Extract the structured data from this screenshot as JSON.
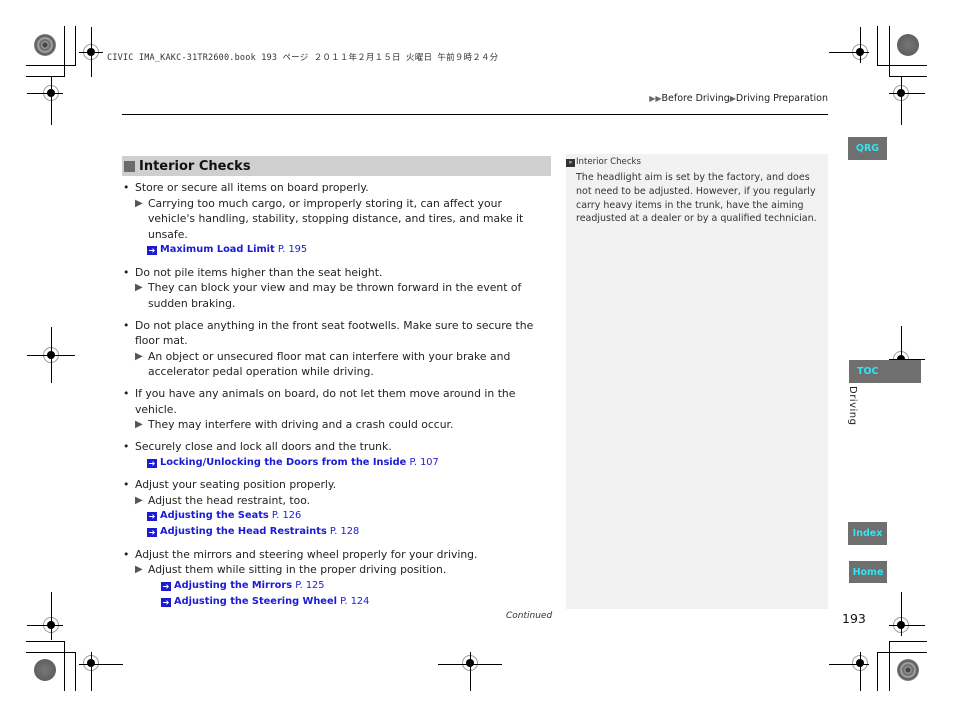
{
  "print_header": "CIVIC IMA_KAKC-31TR2600.book  193 ページ  ２０１１年２月１５日  火曜日  午前９時２４分",
  "breadcrumb": {
    "arrows": "▶▶",
    "part1": "Before Driving",
    "sep": "▶",
    "part2": "Driving Preparation"
  },
  "section": {
    "heading": "Interior Checks",
    "items": [
      {
        "text": "Store or secure all items on board properly.",
        "sub": "Carrying too much cargo, or improperly storing it, can affect your vehicle's handling, stability, stopping distance, and tires, and make it unsafe.",
        "refs": [
          {
            "title": "Maximum Load Limit",
            "page": "P. 195"
          }
        ]
      },
      {
        "text": "Do not pile items higher than the seat height.",
        "sub": "They can block your view and may be thrown forward in the event of sudden braking."
      },
      {
        "text": "Do not place anything in the front seat footwells. Make sure to secure the floor mat.",
        "sub": "An object or unsecured floor mat can interfere with your brake and accelerator pedal operation while driving."
      },
      {
        "text": "If you have any animals on board, do not let them move around in the vehicle.",
        "sub": "They may interfere with driving and a crash could occur."
      },
      {
        "text": "Securely close and lock all doors and the trunk.",
        "refs": [
          {
            "title": "Locking/Unlocking the Doors from the Inside",
            "page": "P. 107"
          }
        ]
      },
      {
        "text": "Adjust your seating position properly.",
        "sub": "Adjust the head restraint, too.",
        "refs": [
          {
            "title": "Adjusting the Seats",
            "page": "P. 126"
          },
          {
            "title": "Adjusting the Head Restraints",
            "page": "P. 128"
          }
        ]
      },
      {
        "text": "Adjust the mirrors and steering wheel properly for your driving.",
        "sub": "Adjust them while sitting in the proper driving position.",
        "refs": [
          {
            "title": "Adjusting the Mirrors",
            "page": "P. 125"
          },
          {
            "title": "Adjusting the Steering Wheel",
            "page": "P. 124"
          }
        ]
      }
    ]
  },
  "side_note": {
    "title": "Interior Checks",
    "body": "The headlight aim is set by the factory, and does not need to be adjusted. However, if you regularly carry heavy items in the trunk, have the aiming readjusted at a dealer or by a qualified technician."
  },
  "nav": {
    "qrg": "QRG",
    "toc": "TOC",
    "index": "Index",
    "home": "Home",
    "section_label": "Driving"
  },
  "continued": "Continued",
  "page_number": "193",
  "colors": {
    "link": "#1b1bd6",
    "tab_bg": "#6f6f6f",
    "tab_text": "#2ee6f2",
    "heading_bg": "#cfcfcf",
    "note_bg": "#f2f2f2"
  },
  "symbols": {
    "bullet": "•",
    "sub_marker": "▶",
    "ref_marker": "➔",
    "note_marker": "»"
  }
}
